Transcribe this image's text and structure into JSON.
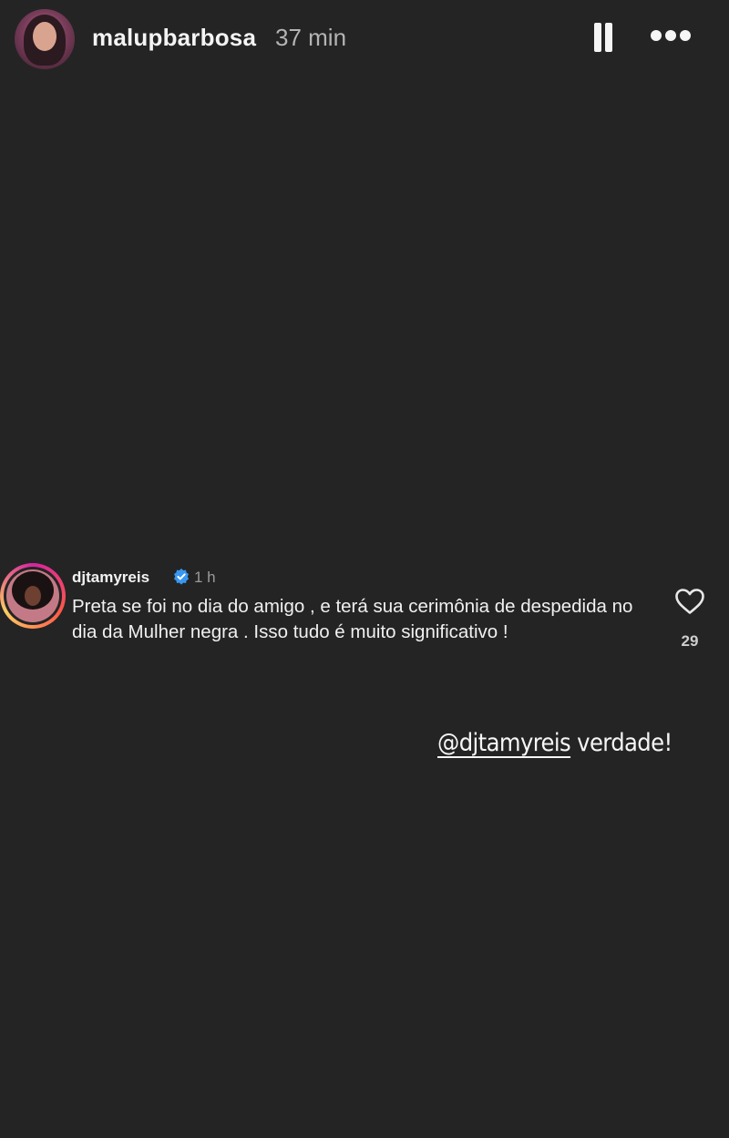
{
  "story": {
    "username": "malupbarbosa",
    "time": "37 min"
  },
  "comment": {
    "username": "djtamyreis",
    "time": "1 h",
    "text": "Preta se foi no dia do amigo , e terá sua cerimônia de despedida no dia da Mulher negra . Isso tudo é muito significativo !",
    "likes": "29"
  },
  "caption": {
    "mention": "@djtamyreis",
    "text": " verdade!"
  },
  "colors": {
    "background": "#242424",
    "verified": "#3897f0"
  },
  "icons": [
    "pause-icon",
    "more-icon",
    "verified-icon",
    "heart-icon"
  ]
}
